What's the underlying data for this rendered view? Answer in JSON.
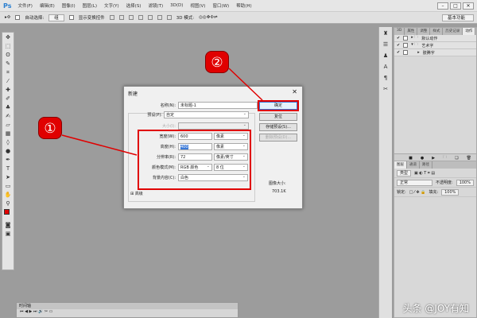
{
  "app": {
    "logo": "Ps",
    "menus": [
      "文件(F)",
      "编辑(E)",
      "图像(I)",
      "图层(L)",
      "文字(Y)",
      "选择(S)",
      "滤镜(T)",
      "3D(D)",
      "视图(V)",
      "窗口(W)",
      "帮助(H)"
    ],
    "window_buttons": [
      "–",
      "□",
      "✕"
    ]
  },
  "options": {
    "auto_select": "自动选择:",
    "layer_select": "组",
    "show_transform": "显示变换控件",
    "mode": "3D 模式:",
    "workspace": "基本功能"
  },
  "panels": {
    "top_tabs": [
      "3D",
      "属性",
      "调整",
      "样式",
      "历史记录",
      "动作"
    ],
    "actions": [
      {
        "name": "默认动作"
      },
      {
        "name": "艺术字"
      },
      {
        "name": "肢腾字"
      }
    ],
    "bottom_tabs": [
      "图层",
      "通道",
      "路径"
    ],
    "kind": "类型",
    "blend": "正常",
    "opacity_label": "不透明度:",
    "opacity": "100%",
    "lock_label": "锁定:",
    "fill_label": "填充:",
    "fill": "100%"
  },
  "timeline": {
    "label": "时间轴"
  },
  "dialog": {
    "title": "新建",
    "close": "✕",
    "name_label": "名称(N):",
    "name": "未标题-1",
    "preset_label": "预设(P):",
    "preset": "自定",
    "size_label": "大小(I):",
    "width_label": "宽度(W):",
    "width": "600",
    "width_unit": "像素",
    "height_label": "高度(H):",
    "height": "400",
    "height_unit": "像素",
    "res_label": "分辨率(R):",
    "res": "72",
    "res_unit": "像素/英寸",
    "color_label": "颜色模式(M):",
    "color": "RGB 颜色",
    "bits": "8 位",
    "bg_label": "背景内容(C):",
    "bg": "白色",
    "advanced": "高级",
    "ok": "确定",
    "reset": "复位",
    "save_preset": "存储预设(S)...",
    "delete_preset": "删除预设(D)...",
    "image_size_label": "图像大小:",
    "image_size": "703.1K"
  },
  "callouts": {
    "one": "①",
    "two": "②"
  },
  "watermark": "头条 @JOY有知"
}
